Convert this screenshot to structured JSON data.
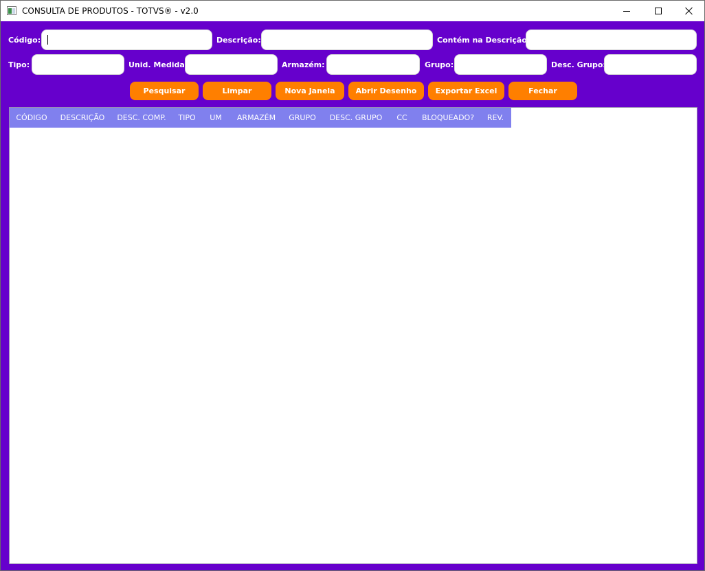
{
  "window": {
    "title": "CONSULTA DE PRODUTOS - TOTVS® - v2.0",
    "icon": "app-window-icon",
    "controls": [
      "minimize-icon",
      "maximize-icon",
      "close-icon"
    ]
  },
  "filters": {
    "codigo": {
      "label": "Código:",
      "value": ""
    },
    "descricao": {
      "label": "Descrição:",
      "value": ""
    },
    "contem_descricao": {
      "label": "Contém na Descrição:",
      "value": ""
    },
    "tipo": {
      "label": "Tipo:",
      "value": ""
    },
    "unid_medida": {
      "label": "Unid. Medida:",
      "value": ""
    },
    "armazem": {
      "label": "Armazém:",
      "value": ""
    },
    "grupo": {
      "label": "Grupo:",
      "value": ""
    },
    "desc_grupo": {
      "label": "Desc. Grupo:",
      "value": ""
    }
  },
  "buttons": {
    "pesquisar": "Pesquisar",
    "limpar": "Limpar",
    "nova_janela": "Nova Janela",
    "abrir_desenho": "Abrir Desenho",
    "exportar_excel": "Exportar Excel",
    "fechar": "Fechar"
  },
  "table": {
    "columns": [
      "CÓDIGO",
      "DESCRIÇÃO",
      "DESC. COMP.",
      "TIPO",
      "UM",
      "ARMAZÉM",
      "GRUPO",
      "DESC. GRUPO",
      "CC",
      "BLOQUEADO?",
      "REV."
    ],
    "rows": []
  },
  "colors": {
    "background": "#6600cc",
    "button": "#ff7f00",
    "header": "#8080ee",
    "text_on_dark": "#ffffff"
  }
}
